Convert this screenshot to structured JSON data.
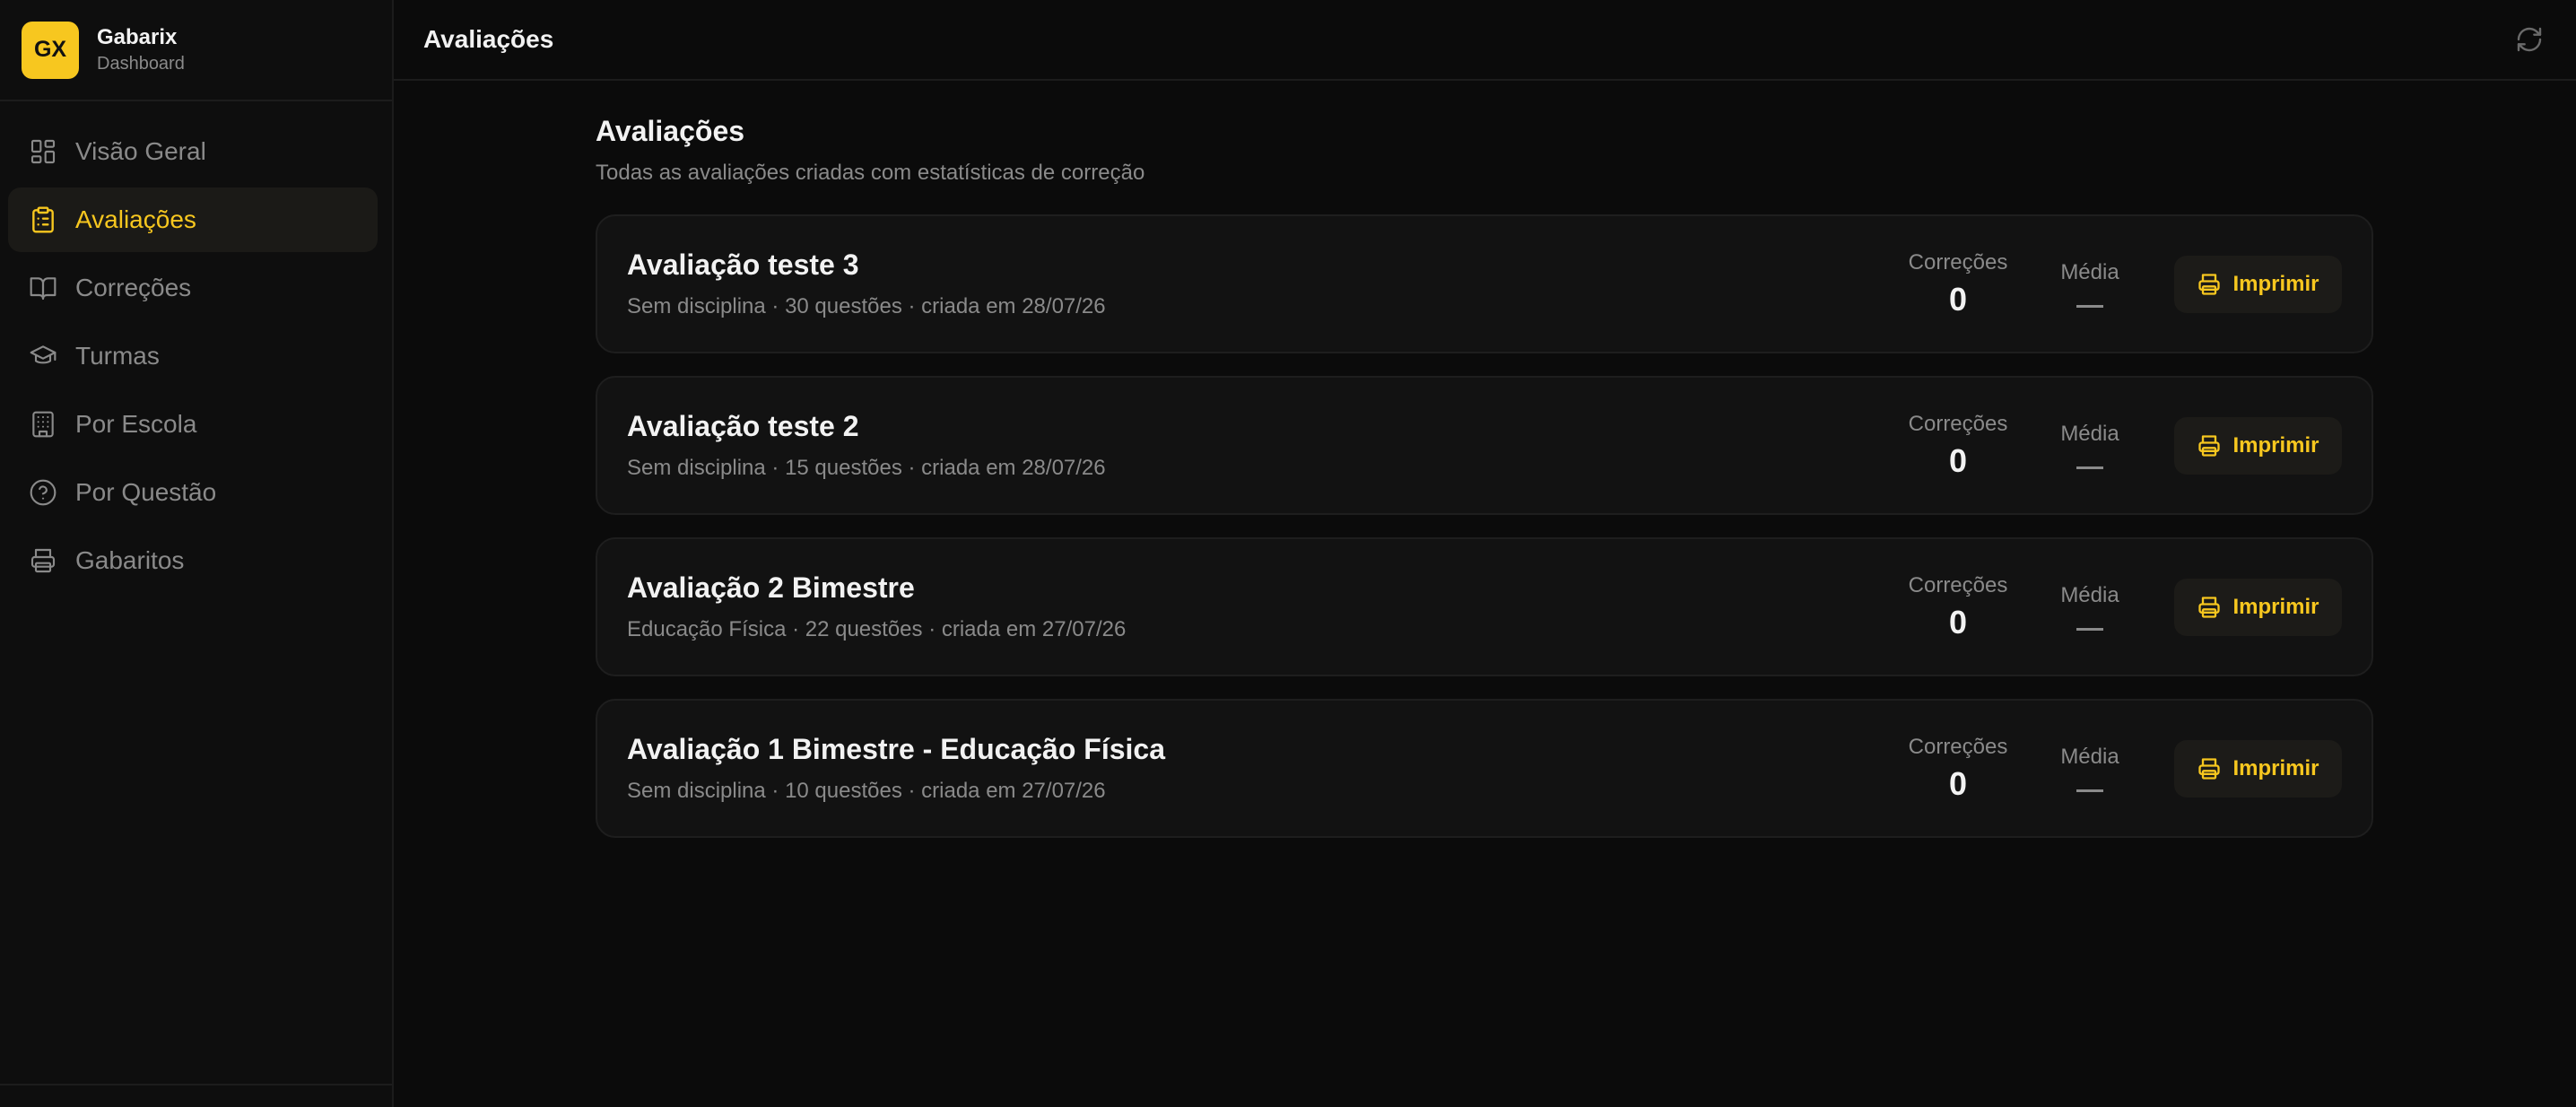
{
  "brand": {
    "logo": "GX",
    "name": "Gabarix",
    "subtitle": "Dashboard"
  },
  "sidebar": {
    "items": [
      {
        "label": "Visão Geral",
        "icon": "grid-icon",
        "active": false
      },
      {
        "label": "Avaliações",
        "icon": "clipboard-icon",
        "active": true
      },
      {
        "label": "Correções",
        "icon": "book-icon",
        "active": false
      },
      {
        "label": "Turmas",
        "icon": "graduation-cap-icon",
        "active": false
      },
      {
        "label": "Por Escola",
        "icon": "building-icon",
        "active": false
      },
      {
        "label": "Por Questão",
        "icon": "help-circle-icon",
        "active": false
      },
      {
        "label": "Gabaritos",
        "icon": "printer-icon",
        "active": false
      }
    ]
  },
  "topbar": {
    "title": "Avaliações",
    "refresh_icon": "refresh-icon"
  },
  "page": {
    "title": "Avaliações",
    "subtitle": "Todas as avaliações criadas com estatísticas de correção"
  },
  "labels": {
    "corrections": "Correções",
    "average": "Média",
    "print": "Imprimir"
  },
  "evaluations": [
    {
      "title": "Avaliação teste 3",
      "meta": "Sem disciplina · 30 questões · criada em 28/07/26",
      "corrections": "0",
      "average": "—"
    },
    {
      "title": "Avaliação teste 2",
      "meta": "Sem disciplina · 15 questões · criada em 28/07/26",
      "corrections": "0",
      "average": "—"
    },
    {
      "title": "Avaliação 2 Bimestre",
      "meta": "Educação Física · 22 questões · criada em 27/07/26",
      "corrections": "0",
      "average": "—"
    },
    {
      "title": "Avaliação 1 Bimestre - Educação Física",
      "meta": "Sem disciplina · 10 questões · criada em 27/07/26",
      "corrections": "0",
      "average": "—"
    }
  ],
  "colors": {
    "accent": "#f7c71f",
    "background": "#0b0b0b",
    "muted": "#8a8a8a"
  }
}
